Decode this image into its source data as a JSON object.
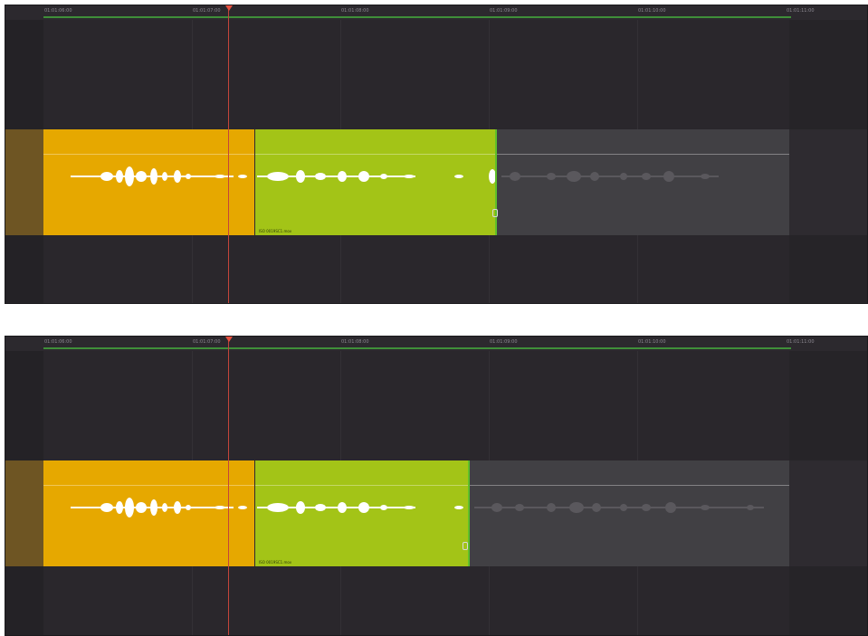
{
  "panels": [
    {
      "ruler": {
        "t0": "01:01:06:00",
        "t1": "01:01:07:00",
        "t2": "01:01:08:00",
        "t3": "01:01:09:00",
        "t4": "01:01:10:00",
        "t5": "01:01:11:00"
      },
      "clip_label": "ISO 0019SC1.mov"
    },
    {
      "ruler": {
        "t0": "01:01:06:00",
        "t1": "01:01:07:00",
        "t2": "01:01:08:00",
        "t3": "01:01:09:00",
        "t4": "01:01:10:00",
        "t5": "01:01:11:00"
      },
      "clip_label": "ISO 0019SC1.mov"
    }
  ],
  "colors": {
    "background": "#2a272c",
    "orange_clip": "#e6a800",
    "green_clip": "#a3c417",
    "gray_region": "#414044",
    "playhead": "#c4453a",
    "range_line": "#3f8f39"
  }
}
